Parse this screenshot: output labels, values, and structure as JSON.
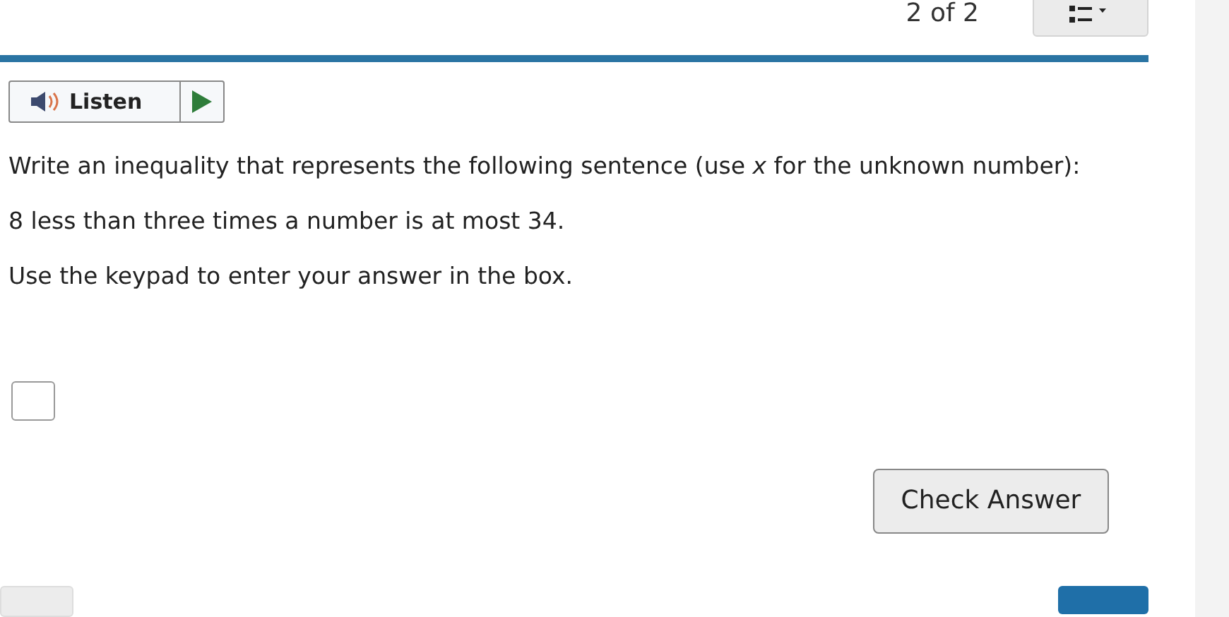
{
  "header": {
    "progress": "2 of 2"
  },
  "listen": {
    "label": "Listen"
  },
  "question": {
    "prompt": "Write an inequality that represents the following sentence (use *x* for the unknown number):",
    "sentence": "8 less than three times a number is at most 34.",
    "instruction": "Use the keypad to enter your answer in the box."
  },
  "buttons": {
    "check": "Check Answer"
  }
}
